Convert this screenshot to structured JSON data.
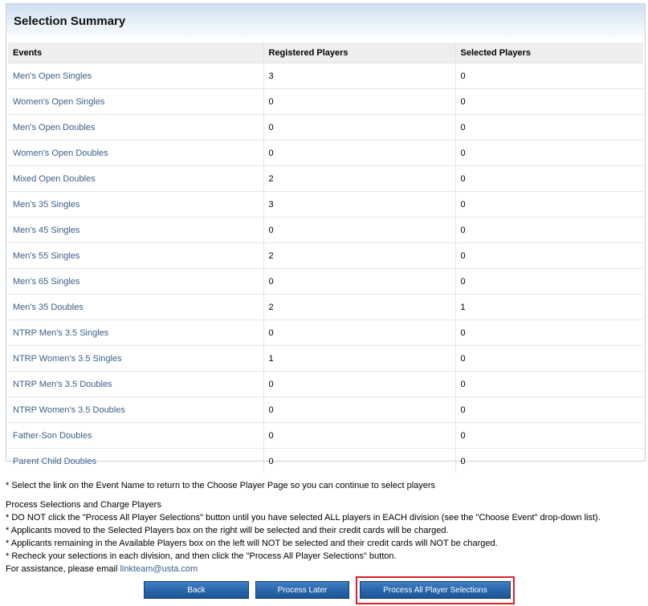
{
  "summary": {
    "title": "Selection Summary",
    "columns": [
      "Events",
      "Registered Players",
      "Selected Players"
    ],
    "rows": [
      {
        "event": "Men's Open Singles",
        "registered": "3",
        "selected": "0"
      },
      {
        "event": "Women's Open Singles",
        "registered": "0",
        "selected": "0"
      },
      {
        "event": "Men's Open Doubles",
        "registered": "0",
        "selected": "0"
      },
      {
        "event": "Women's Open Doubles",
        "registered": "0",
        "selected": "0"
      },
      {
        "event": "Mixed Open Doubles",
        "registered": "2",
        "selected": "0"
      },
      {
        "event": "Men's 35 Singles",
        "registered": "3",
        "selected": "0"
      },
      {
        "event": "Men's 45 Singles",
        "registered": "0",
        "selected": "0"
      },
      {
        "event": "Men's 55 Singles",
        "registered": "2",
        "selected": "0"
      },
      {
        "event": "Men's 65 Singles",
        "registered": "0",
        "selected": "0"
      },
      {
        "event": "Men's 35 Doubles",
        "registered": "2",
        "selected": "1"
      },
      {
        "event": "NTRP Men's 3.5 Singles",
        "registered": "0",
        "selected": "0"
      },
      {
        "event": "NTRP Women's 3.5 Singles",
        "registered": "1",
        "selected": "0"
      },
      {
        "event": "NTRP Men's 3.5 Doubles",
        "registered": "0",
        "selected": "0"
      },
      {
        "event": "NTRP Women's 3.5 Doubles",
        "registered": "0",
        "selected": "0"
      },
      {
        "event": "Father-Son Doubles",
        "registered": "0",
        "selected": "0"
      },
      {
        "event": "Parent Child Doubles",
        "registered": "0",
        "selected": "0"
      }
    ]
  },
  "notes": {
    "select_link_note": "* Select the link on the Event Name to return to the Choose Player Page so you can continue to select players",
    "process_heading": "Process Selections and Charge Players",
    "bullets": [
      "* DO NOT click the \"Process All Player Selections\" button until you have selected ALL players in EACH division (see the \"Choose Event\" drop-down list).",
      "* Applicants moved to the Selected Players box on the right will be selected and their credit cards will be charged.",
      "* Applicants remaining in the Available Players box on the left will NOT be selected and their credit cards will NOT be charged.",
      "* Recheck your selections in each division, and then click the \"Process All Player Selections\" button."
    ],
    "assistance_prefix": "For assistance, please email ",
    "assistance_email": "linkteam@usta.com"
  },
  "buttons": {
    "back": "Back",
    "process_later": "Process Later",
    "process_all": "Process All Player Selections"
  },
  "colors": {
    "link": "#3a5f8a",
    "button_blue": "#2a66aa",
    "highlight": "#d9222a"
  }
}
